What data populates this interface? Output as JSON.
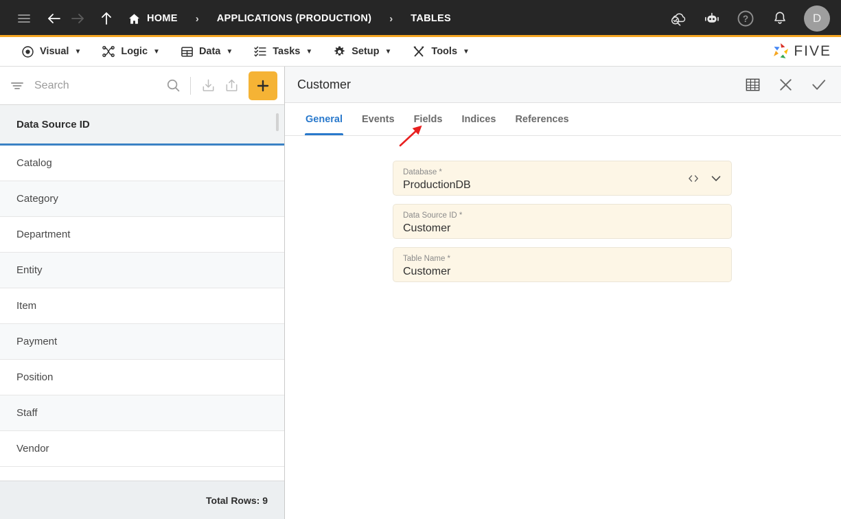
{
  "topbar": {
    "menu_icon": "hamburger-menu-icon",
    "back_icon": "arrow-back-icon",
    "forward_icon": "arrow-forward-icon",
    "up_icon": "arrow-up-icon",
    "breadcrumbs": [
      {
        "label": "HOME",
        "icon": "home-icon"
      },
      {
        "label": "APPLICATIONS (PRODUCTION)",
        "icon": ""
      },
      {
        "label": "TABLES",
        "icon": ""
      }
    ],
    "separator": "›",
    "right_icons": [
      {
        "name": "cloud-check-icon"
      },
      {
        "name": "chat-bot-icon"
      },
      {
        "name": "help-icon"
      },
      {
        "name": "notifications-bell-icon"
      }
    ],
    "avatar_initial": "D",
    "accent_color": "#f5a623",
    "background_color": "#262626"
  },
  "menubar": {
    "items": [
      {
        "label": "Visual",
        "icon": "eye-icon",
        "caret": "▼"
      },
      {
        "label": "Logic",
        "icon": "logic-nodes-icon",
        "caret": "▼"
      },
      {
        "label": "Data",
        "icon": "table-grid-icon",
        "caret": "▼"
      },
      {
        "label": "Tasks",
        "icon": "task-list-icon",
        "caret": "▼"
      },
      {
        "label": "Setup",
        "icon": "gear-icon",
        "caret": "▼"
      },
      {
        "label": "Tools",
        "icon": "tools-icon",
        "caret": "▼"
      }
    ],
    "logo_text": "FIVE",
    "logo_icon": "five-pinwheel-icon"
  },
  "sidebar": {
    "search": {
      "placeholder": "Search",
      "value": "",
      "filter_icon": "filter-icon",
      "search_icon": "search-icon",
      "import_icon": "import-icon",
      "export_icon": "export-icon",
      "add_label": "+",
      "add_icon": "plus-icon",
      "add_color": "#f5b335"
    },
    "column_header": "Data Source ID",
    "rows": [
      {
        "label": "Catalog"
      },
      {
        "label": "Category"
      },
      {
        "label": "Department"
      },
      {
        "label": "Entity"
      },
      {
        "label": "Item"
      },
      {
        "label": "Payment"
      },
      {
        "label": "Position"
      },
      {
        "label": "Staff"
      },
      {
        "label": "Vendor"
      }
    ],
    "footer_text": "Total Rows: 9",
    "selected_accent": "#3b82c4"
  },
  "detail": {
    "title": "Customer",
    "actions": [
      {
        "name": "grid-view-icon"
      },
      {
        "name": "close-icon"
      },
      {
        "name": "confirm-check-icon"
      }
    ],
    "tabs": [
      {
        "label": "General",
        "active": true
      },
      {
        "label": "Events",
        "active": false
      },
      {
        "label": "Fields",
        "active": false
      },
      {
        "label": "Indices",
        "active": false
      },
      {
        "label": "References",
        "active": false
      }
    ],
    "active_tab_color": "#2979cc",
    "fields": [
      {
        "label": "Database *",
        "value": "ProductionDB",
        "has_code_icon": true,
        "has_dropdown": true,
        "code_icon": "code-brackets-icon",
        "dropdown_icon": "chevron-down-icon"
      },
      {
        "label": "Data Source ID *",
        "value": "Customer",
        "has_code_icon": false,
        "has_dropdown": false
      },
      {
        "label": "Table Name *",
        "value": "Customer",
        "has_code_icon": false,
        "has_dropdown": false
      }
    ],
    "field_background": "#fdf6e6"
  },
  "annotation": {
    "arrow_color": "#e82020",
    "points_to": "Fields",
    "name": "red-annotation-arrow"
  }
}
